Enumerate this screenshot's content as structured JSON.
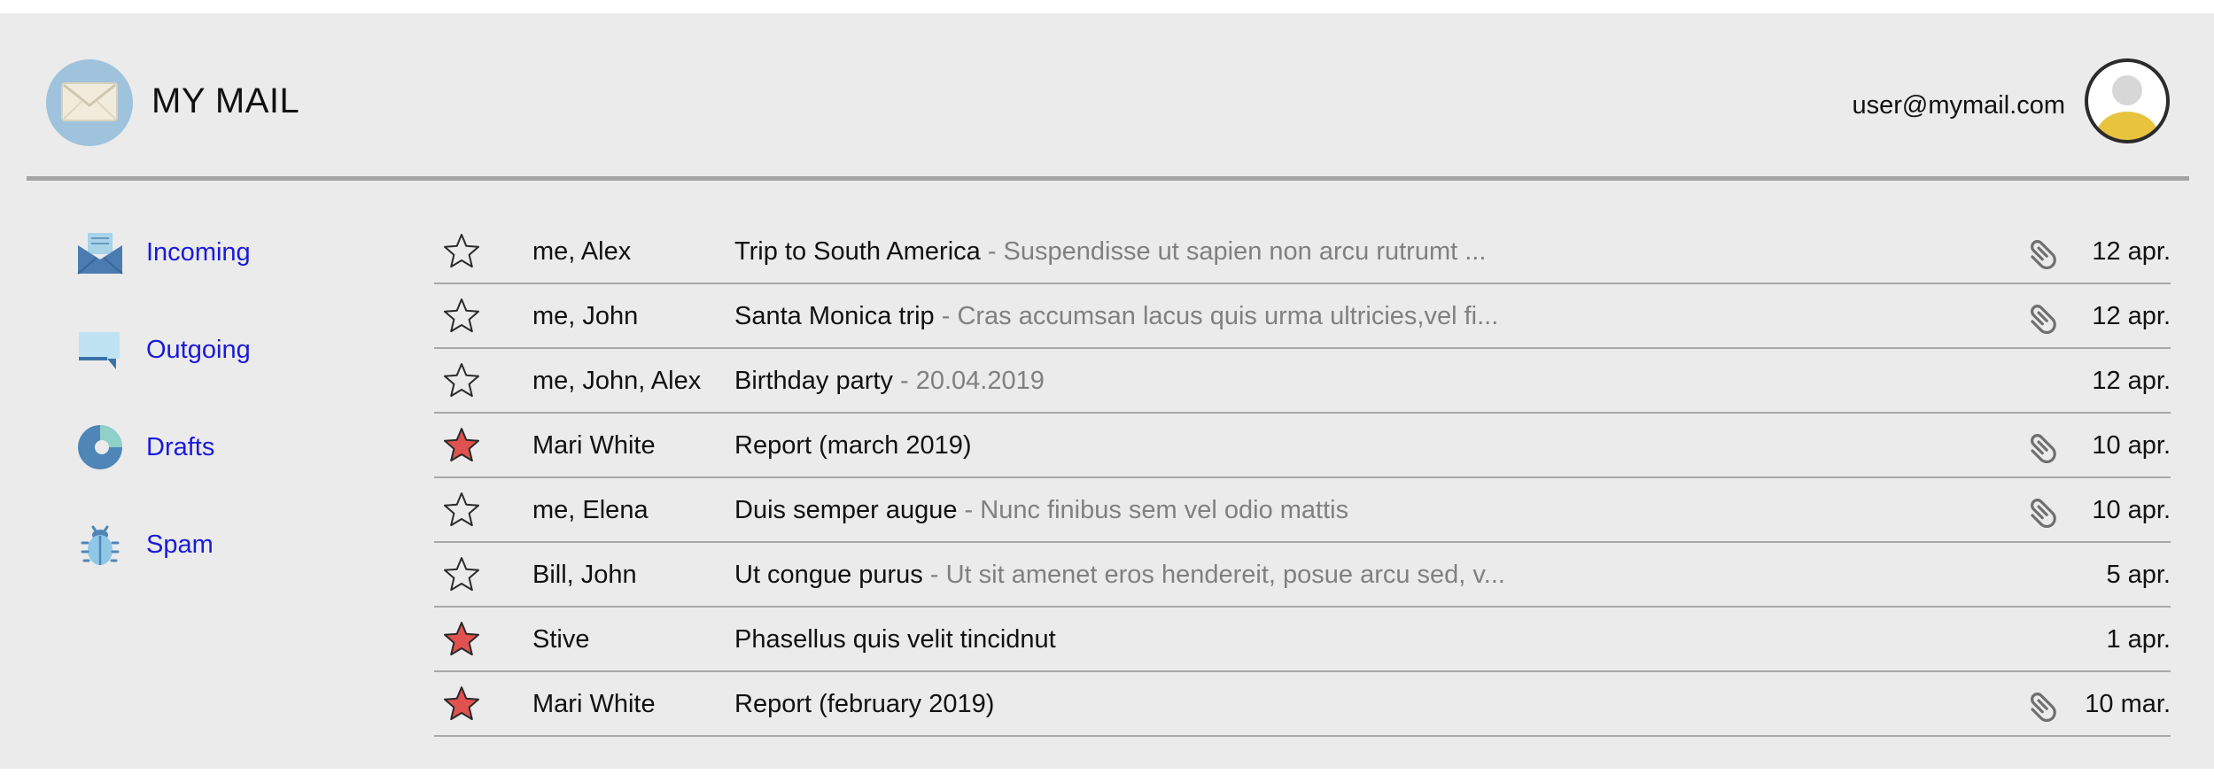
{
  "header": {
    "app_title": "MY MAIL",
    "user_email": "user@mymail.com"
  },
  "sidebar": {
    "items": [
      {
        "label": "Incoming",
        "icon": "incoming-icon"
      },
      {
        "label": "Outgoing",
        "icon": "outgoing-icon"
      },
      {
        "label": "Drafts",
        "icon": "drafts-icon"
      },
      {
        "label": "Spam",
        "icon": "spam-icon"
      }
    ]
  },
  "mails": [
    {
      "starred": false,
      "sender": "me, Alex",
      "subject": "Trip to South America",
      "snippet": " - Suspendisse ut sapien non arcu rutrumt ...",
      "attachment": true,
      "date": "12 apr."
    },
    {
      "starred": false,
      "sender": "me, John",
      "subject": "Santa Monica trip",
      "snippet": " - Cras accumsan lacus quis urma ultricies,vel fi...",
      "attachment": true,
      "date": "12 apr."
    },
    {
      "starred": false,
      "sender": "me, John, Alex",
      "subject": "Birthday party",
      "snippet": " - 20.04.2019",
      "attachment": false,
      "date": "12 apr."
    },
    {
      "starred": true,
      "sender": "Mari White",
      "subject": "Report (march 2019)",
      "snippet": "",
      "attachment": true,
      "date": "10 apr."
    },
    {
      "starred": false,
      "sender": "me, Elena",
      "subject": "Duis semper augue",
      "snippet": " - Nunc finibus sem vel odio mattis",
      "attachment": true,
      "date": "10 apr."
    },
    {
      "starred": false,
      "sender": "Bill, John",
      "subject": "Ut congue purus",
      "snippet": " - Ut sit amenet eros hendereit, posue arcu sed, v...",
      "attachment": false,
      "date": "5 apr."
    },
    {
      "starred": true,
      "sender": "Stive",
      "subject": "Phasellus quis velit tincidnut",
      "snippet": "",
      "attachment": false,
      "date": "1 apr."
    },
    {
      "starred": true,
      "sender": "Mari White",
      "subject": "Report (february 2019)",
      "snippet": "",
      "attachment": true,
      "date": "10 mar."
    }
  ],
  "colors": {
    "background": "#ebebeb",
    "link": "#1a1adb",
    "star_active": "#e0524f",
    "snippet": "#808080"
  }
}
